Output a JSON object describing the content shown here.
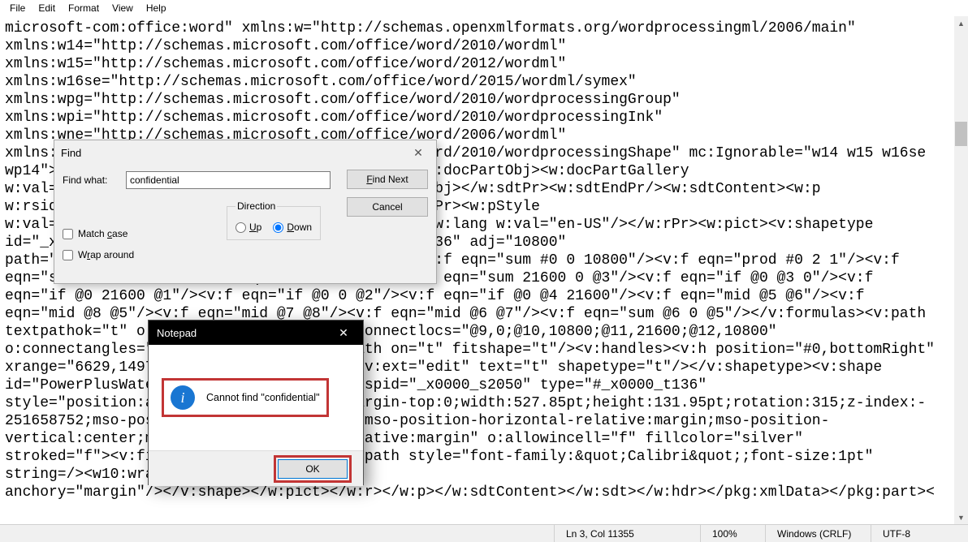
{
  "menubar": {
    "file": "File",
    "edit": "Edit",
    "format": "Format",
    "view": "View",
    "help": "Help"
  },
  "editor": {
    "text": "microsoft-com:office:word\" xmlns:w=\"http://schemas.openxmlformats.org/wordprocessingml/2006/main\"\nxmlns:w14=\"http://schemas.microsoft.com/office/word/2010/wordml\"\nxmlns:w15=\"http://schemas.microsoft.com/office/word/2012/wordml\"\nxmlns:w16se=\"http://schemas.microsoft.com/office/word/2015/wordml/symex\"\nxmlns:wpg=\"http://schemas.microsoft.com/office/word/2010/wordprocessingGroup\"\nxmlns:wpi=\"http://schemas.microsoft.com/office/word/2010/wordprocessingInk\"\nxmlns:wne=\"http://schemas.microsoft.com/office/word/2006/wordml\"\nxmlns:wps=\"http://schemas.microsoft.com/office/word/2010/wordprocessingShape\" mc:Ignorable=\"w14 w15 w16se\nwp14\"><w:sdt><w:sdtPr><w:id w:val=\"686716726\"/><w:docPartObj><w:docPartGallery\nw:val=\"Watermark\"/><w:docPartUnique/></w:docPartObj></w:sdtPr><w:sdtEndPr/><w:sdtContent><w:p\nw:rsidR=\"00975EF4\" w:rsidRDefault=\"00975EF4\"><w:pPr><w:pStyle\nw:val=\"Header\"/></w:pPr><w:r><w:rPr><w:noProof/><w:lang w:val=\"en-US\"/></w:rPr><w:pict><v:shapetype\nid=\"_x0000_t136\" coordsize=\"21600,21600\" o:spt=\"136\" adj=\"10800\"\npath=\"m@7,l@8,m@5,21600l@6,21600e\"><v:formulas><v:f eqn=\"sum #0 0 10800\"/><v:f eqn=\"prod #0 2 1\"/><v:f\neqn=\"sum 21600 0 @1\"/><v:f eqn=\"sum 0 0 @2\"/><v:f eqn=\"sum 21600 0 @3\"/><v:f eqn=\"if @0 @3 0\"/><v:f\neqn=\"if @0 21600 @1\"/><v:f eqn=\"if @0 0 @2\"/><v:f eqn=\"if @0 @4 21600\"/><v:f eqn=\"mid @5 @6\"/><v:f\neqn=\"mid @8 @5\"/><v:f eqn=\"mid @7 @8\"/><v:f eqn=\"mid @6 @7\"/><v:f eqn=\"sum @6 0 @5\"/></v:formulas><v:path\ntextpathok=\"t\" o:connecttype=\"custom\" o:connectlocs=\"@9,0;@10,10800;@11,21600;@12,10800\"\no:connectangles=\"270,180,90,0\"/><v:textpath on=\"t\" fitshape=\"t\"/><v:handles><v:h position=\"#0,bottomRight\"\nxrange=\"6629,14971\"/></v:handles><o:lock v:ext=\"edit\" text=\"t\" shapetype=\"t\"/></v:shapetype><v:shape\nid=\"PowerPlusWaterMarkObject357476642\" o:spid=\"_x0000_s2050\" type=\"#_x0000_t136\"\nstyle=\"position:absolute;margin-left:0;margin-top:0;width:527.85pt;height:131.95pt;rotation:315;z-index:-\n251658752;mso-position-horizontal:center;mso-position-horizontal-relative:margin;mso-position-\nvertical:center;mso-position-vertical-relative:margin\" o:allowincell=\"f\" fillcolor=\"silver\"\nstroked=\"f\"><v:fill opacity=\".5\"/><v:textpath style=\"font-family:&quot;Calibri&quot;;font-size:1pt\"\nstring=/><w10:wrap anchorx=\"margin\"\nanchory=\"margin\"/></v:shape></w:pict></w:r></w:p></w:sdtContent></w:sdt></w:hdr></pkg:xmlData></pkg:part><"
  },
  "find": {
    "title": "Find",
    "findwhat_label": "Find what:",
    "findwhat_value": "confidential",
    "findnext_label": "Find Next",
    "cancel_label": "Cancel",
    "direction_label": "Direction",
    "up_label": "Up",
    "down_label": "Down",
    "direction_value": "down",
    "matchcase_label": "Match case",
    "wraparound_label": "Wrap around",
    "matchcase_checked": false,
    "wraparound_checked": false
  },
  "alert": {
    "title": "Notepad",
    "message": "Cannot find \"confidential\"",
    "ok_label": "OK"
  },
  "statusbar": {
    "position": "Ln 3, Col 11355",
    "zoom": "100%",
    "eol": "Windows (CRLF)",
    "encoding": "UTF-8"
  }
}
